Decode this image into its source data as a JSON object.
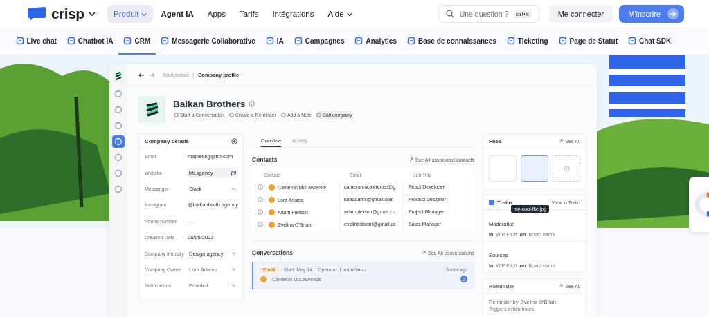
{
  "header": {
    "logo": "crisp",
    "nav": [
      {
        "label": "Produit",
        "kind": "dropdown",
        "selected": true
      },
      {
        "label": "Agent IA",
        "kind": "featured",
        "selected": false
      },
      {
        "label": "Apps",
        "kind": "link",
        "selected": false
      },
      {
        "label": "Tarifs",
        "kind": "link",
        "selected": false
      },
      {
        "label": "Intégrations",
        "kind": "link",
        "selected": false
      },
      {
        "label": "Aide",
        "kind": "dropdown",
        "selected": false
      }
    ],
    "search": {
      "placeholder": "Une question ?",
      "shortcut": "ctrl+k"
    },
    "login": "Me connecter",
    "signup": "M'inscrire"
  },
  "products": [
    {
      "label": "Live chat",
      "selected": false
    },
    {
      "label": "Chatbot IA",
      "selected": false
    },
    {
      "label": "CRM",
      "selected": true
    },
    {
      "label": "Messagerie Collaborative",
      "selected": false
    },
    {
      "label": "IA",
      "selected": false
    },
    {
      "label": "Campagnes",
      "selected": false
    },
    {
      "label": "Analytics",
      "selected": false
    },
    {
      "label": "Base de connaissances",
      "selected": false
    },
    {
      "label": "Ticketing",
      "selected": false
    },
    {
      "label": "Page de Statut",
      "selected": false
    },
    {
      "label": "Chat SDK",
      "selected": false
    }
  ],
  "app": {
    "sidebar": [
      {
        "selected": false
      },
      {
        "selected": false
      },
      {
        "selected": false
      },
      {
        "selected": true
      },
      {
        "selected": false
      },
      {
        "selected": false
      },
      {
        "selected": false
      }
    ],
    "breadcrumb": [
      "Companies",
      "Company profile"
    ],
    "company": {
      "name": "Balkan Brothers",
      "actions": [
        "Start a Conversation",
        "Create a Reminder",
        "Add a Note",
        "Call company"
      ]
    },
    "details": {
      "title": "Company details",
      "fields": [
        {
          "label": "Email",
          "value": "marketing@bb.com",
          "kind": "text"
        },
        {
          "label": "Website",
          "value": "bb.agency",
          "kind": "copy"
        },
        {
          "label": "Messenger",
          "value": "Slack",
          "kind": "select"
        },
        {
          "label": "Instagram",
          "value": "@balkanbroth.agency",
          "kind": "text"
        },
        {
          "label": "Phone number",
          "value": "—",
          "kind": "text"
        },
        {
          "label": "Creation Date",
          "value": "06/05/2023",
          "kind": "text"
        },
        {
          "label": "Company Industry",
          "value": "Design agency",
          "kind": "select"
        },
        {
          "label": "Company Owner",
          "value": "Lora Adams",
          "kind": "select"
        },
        {
          "label": "Notifications",
          "value": "Enabled",
          "kind": "select"
        }
      ]
    },
    "tabs": [
      {
        "label": "Overview",
        "selected": true
      },
      {
        "label": "Activity",
        "selected": false
      }
    ],
    "contacts": {
      "title": "Contacts",
      "link": "See All associated contacts",
      "columns": [
        "Contact",
        "Email",
        "Job Title"
      ],
      "rows": [
        {
          "name": "Cameron McLawrence",
          "email": "cameronmcawrence@g",
          "job": "React Developer"
        },
        {
          "name": "Lora Adams",
          "email": "loraadams@gmail.com",
          "job": "Product Designer"
        },
        {
          "name": "Adam Pierson",
          "email": "adampierson@gmail.co",
          "job": "Project Manager"
        },
        {
          "name": "Evelina O'Brian",
          "email": "evelinaobrian@gmail.cc",
          "job": "Sales Manager"
        }
      ]
    },
    "conversations": {
      "title": "Conversations",
      "link": "See All conversations",
      "item": {
        "channel": "Email",
        "start": "Start: May 14",
        "operator": "Operator: Lora Adams",
        "time": "5 min ago",
        "name": "Cameron McLawrence",
        "count": "2"
      }
    },
    "files": {
      "title": "Files",
      "link": "See All",
      "tooltip": "my-cool-file.jpg"
    },
    "trello": {
      "title": "Trello",
      "link": "View in Trello",
      "cards": [
        {
          "title": "Moderation",
          "in": "in",
          "list": "WIP Eliott",
          "on": "on",
          "board": "Board name"
        },
        {
          "title": "Sources",
          "in": "in",
          "list": "WIP Eliott",
          "on": "on",
          "board": "Board name"
        }
      ]
    },
    "reminder": {
      "title": "Reminder",
      "link": "See All",
      "text": "Reminder by",
      "author": "Evelina O'Brian",
      "sub": "Triggers in two hours"
    }
  }
}
